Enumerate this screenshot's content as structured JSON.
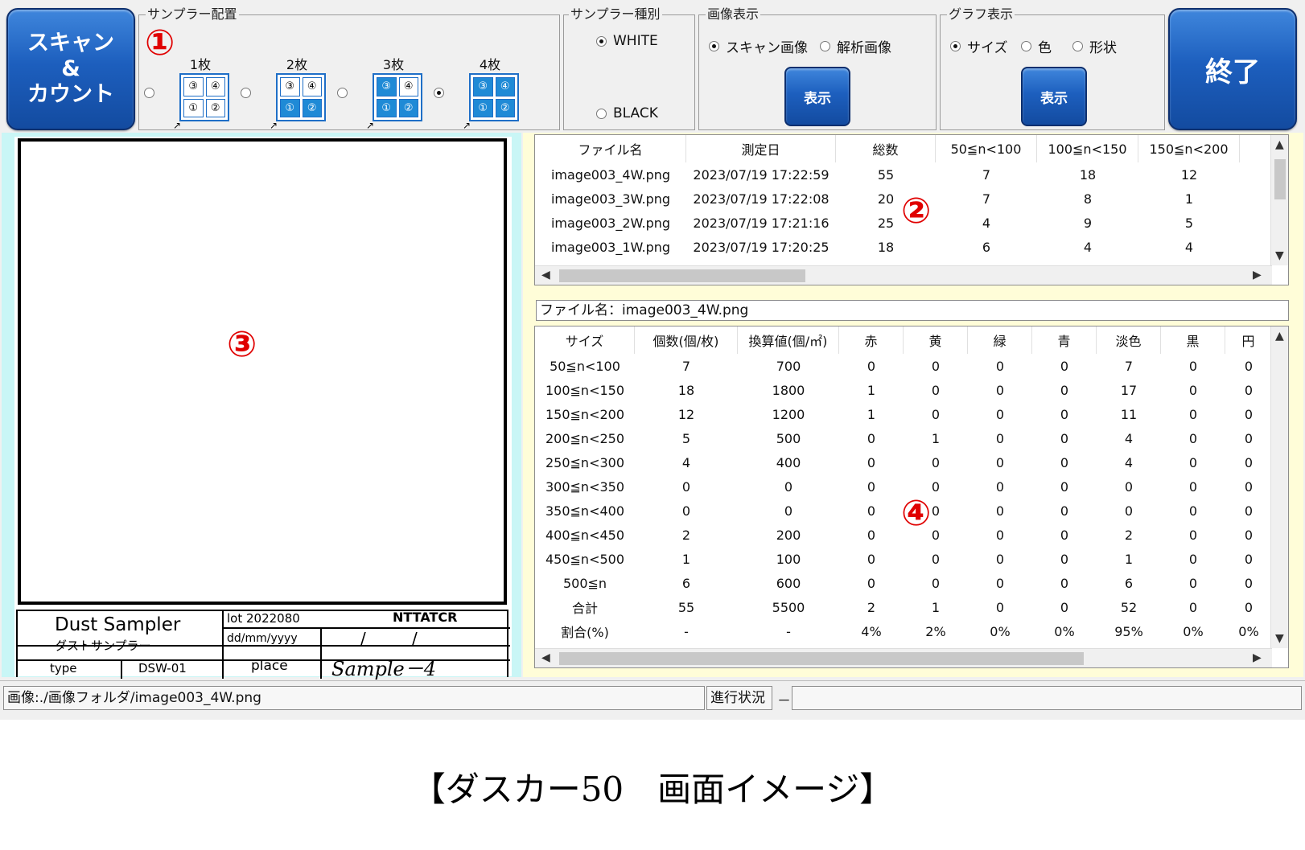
{
  "buttons": {
    "scan_count": "スキャン\n&\nカウント",
    "exit": "終了"
  },
  "sampler_layout": {
    "title": "サンプラー配置",
    "options": [
      {
        "label": "1枚",
        "selected": false,
        "cells": [
          "③",
          "④",
          "①",
          "②"
        ],
        "filled": [
          false,
          false,
          false,
          false
        ]
      },
      {
        "label": "2枚",
        "selected": false,
        "cells": [
          "③",
          "④",
          "①",
          "②"
        ],
        "filled": [
          false,
          false,
          true,
          true
        ]
      },
      {
        "label": "3枚",
        "selected": false,
        "cells": [
          "③",
          "④",
          "①",
          "②"
        ],
        "filled": [
          true,
          false,
          true,
          true
        ]
      },
      {
        "label": "4枚",
        "selected": true,
        "cells": [
          "③",
          "④",
          "①",
          "②"
        ],
        "filled": [
          true,
          true,
          true,
          true
        ]
      }
    ],
    "corner_arrow": "↗"
  },
  "sampler_type": {
    "title": "サンプラー種別",
    "white": "WHITE",
    "black": "BLACK",
    "selected": "WHITE"
  },
  "image_display": {
    "title": "画像表示",
    "scan": "スキャン画像",
    "analysis": "解析画像",
    "selected": "scan",
    "show_button": "表示"
  },
  "graph_display": {
    "title": "グラフ表示",
    "size": "サイズ",
    "color": "色",
    "shape": "形状",
    "selected": "size",
    "show_button": "表示"
  },
  "markers": {
    "m1": "①",
    "m2": "②",
    "m3": "③",
    "m4": "④"
  },
  "scan_label": {
    "product_en": "Dust Sampler",
    "product_jp": "ダストサンプラー",
    "lot": "lot 2022080",
    "brand": "NTTATCR",
    "date_fmt": "dd/mm/yyyy",
    "date_sep1": "/",
    "date_sep2": "/",
    "type_label": "type",
    "type_value": "DSW-01",
    "place_label": "place",
    "place_value": "Sample－4"
  },
  "files_table": {
    "columns": [
      "ファイル名",
      "測定日",
      "総数",
      "50≦n<100",
      "100≦n<150",
      "150≦n<200"
    ],
    "rows": [
      [
        "image003_4W.png",
        "2023/07/19 17:22:59",
        "55",
        "7",
        "18",
        "12"
      ],
      [
        "image003_3W.png",
        "2023/07/19 17:22:08",
        "20",
        "7",
        "8",
        "1"
      ],
      [
        "image003_2W.png",
        "2023/07/19 17:21:16",
        "25",
        "4",
        "9",
        "5"
      ],
      [
        "image003_1W.png",
        "2023/07/19 17:20:25",
        "18",
        "6",
        "4",
        "4"
      ]
    ]
  },
  "selected_file": "ファイル名：image003_4W.png",
  "details_table": {
    "columns": [
      "サイズ",
      "個数(個/枚)",
      "換算値(個/㎡)",
      "赤",
      "黄",
      "緑",
      "青",
      "淡色",
      "黒",
      "円"
    ],
    "rows": [
      [
        "50≦n<100",
        "7",
        "700",
        "0",
        "0",
        "0",
        "0",
        "7",
        "0",
        "0"
      ],
      [
        "100≦n<150",
        "18",
        "1800",
        "1",
        "0",
        "0",
        "0",
        "17",
        "0",
        "0"
      ],
      [
        "150≦n<200",
        "12",
        "1200",
        "1",
        "0",
        "0",
        "0",
        "11",
        "0",
        "0"
      ],
      [
        "200≦n<250",
        "5",
        "500",
        "0",
        "1",
        "0",
        "0",
        "4",
        "0",
        "0"
      ],
      [
        "250≦n<300",
        "4",
        "400",
        "0",
        "0",
        "0",
        "0",
        "4",
        "0",
        "0"
      ],
      [
        "300≦n<350",
        "0",
        "0",
        "0",
        "0",
        "0",
        "0",
        "0",
        "0",
        "0"
      ],
      [
        "350≦n<400",
        "0",
        "0",
        "0",
        "0",
        "0",
        "0",
        "0",
        "0",
        "0"
      ],
      [
        "400≦n<450",
        "2",
        "200",
        "0",
        "0",
        "0",
        "0",
        "2",
        "0",
        "0"
      ],
      [
        "450≦n<500",
        "1",
        "100",
        "0",
        "0",
        "0",
        "0",
        "1",
        "0",
        "0"
      ],
      [
        "500≦n",
        "6",
        "600",
        "0",
        "0",
        "0",
        "0",
        "6",
        "0",
        "0"
      ],
      [
        "合計",
        "55",
        "5500",
        "2",
        "1",
        "0",
        "0",
        "52",
        "0",
        "0"
      ],
      [
        "割合(%)",
        "-",
        "-",
        "4%",
        "2%",
        "0%",
        "0%",
        "95%",
        "0%",
        "0%"
      ]
    ]
  },
  "status": {
    "image_path": "画像:./画像フォルダ/image003_4W.png",
    "progress_label": "進行状況",
    "progress_value": "－"
  },
  "caption": "【ダスカー50　画面イメージ】"
}
